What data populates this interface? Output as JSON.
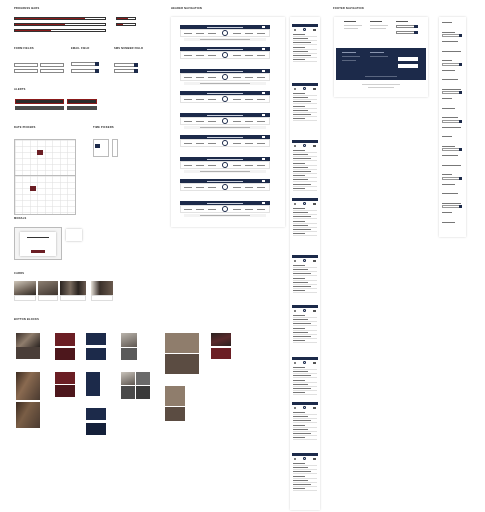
{
  "sections": {
    "progress_bars": "PROGRESS BARS",
    "form_fields": "FORM FIELDS",
    "email_field": "EMAIL FIELD",
    "sms_number_field": "SMS NUMBER FIELD",
    "alerts": "ALERTS",
    "date_pickers": "DATE PICKERS",
    "time_pickers": "TIME PICKERS",
    "modals": "MODALS",
    "cards": "CARDS",
    "button_blocks": "BUTTON BLOCKS",
    "header_navigation": "HEADER NAVIGATION",
    "footer_navigation": "FOOTER NAVIGATION"
  },
  "progress": {
    "values": [
      0.78,
      0.55,
      0.4
    ]
  },
  "colors": {
    "navy": "#1c2a4a",
    "maroon": "#6b1e24",
    "taupe": "#8f7d6c",
    "gray": "#5a5a5a"
  },
  "icons": [
    "seal-icon",
    "hamburger-icon",
    "search-icon",
    "calendar-icon",
    "clock-icon"
  ]
}
